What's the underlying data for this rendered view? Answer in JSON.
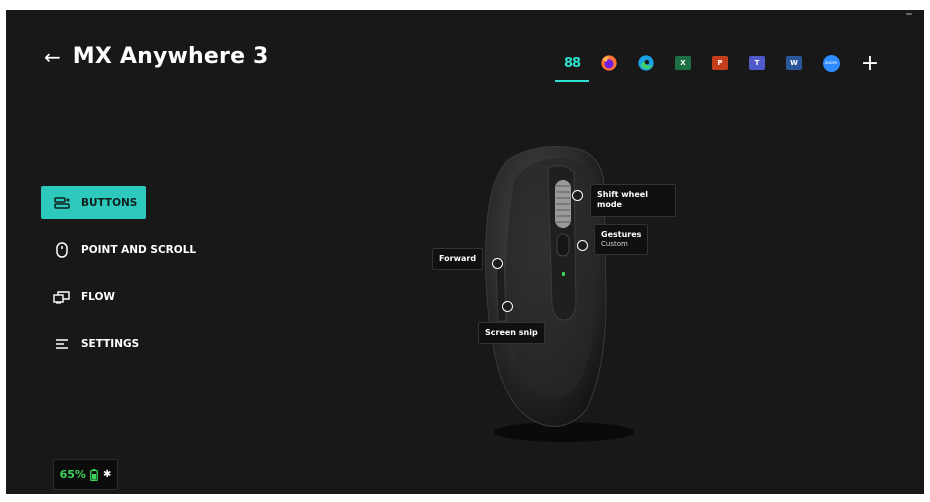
{
  "window": {
    "minimize_label": "–"
  },
  "header": {
    "back_label": "←",
    "title": "MX Anywhere 3"
  },
  "apps": [
    {
      "name": "all-apps",
      "label": "88",
      "color": "#2de0cf"
    },
    {
      "name": "firefox",
      "label": ""
    },
    {
      "name": "edge",
      "label": ""
    },
    {
      "name": "excel",
      "label": "X",
      "color": "#1d7044"
    },
    {
      "name": "powerpoint",
      "label": "P",
      "color": "#c43e1c"
    },
    {
      "name": "teams",
      "label": "T",
      "color": "#5059c9"
    },
    {
      "name": "word",
      "label": "W",
      "color": "#2b579a"
    },
    {
      "name": "zoom",
      "label": "zoom",
      "color": "#2d8cff"
    },
    {
      "name": "add-app",
      "label": "+"
    }
  ],
  "nav": {
    "buttons": "BUTTONS",
    "point_scroll": "POINT AND SCROLL",
    "flow": "FLOW",
    "settings": "SETTINGS"
  },
  "callouts": {
    "shift_wheel": "Shift wheel mode",
    "gestures": "Gestures",
    "gestures_sub": "Custom",
    "forward": "Forward",
    "screen_snip": "Screen snip"
  },
  "battery": {
    "percent": "65%",
    "bluetooth": "✱"
  },
  "colors": {
    "accent": "#2ec9bd",
    "battery_green": "#3cd45a",
    "background": "#181818"
  }
}
